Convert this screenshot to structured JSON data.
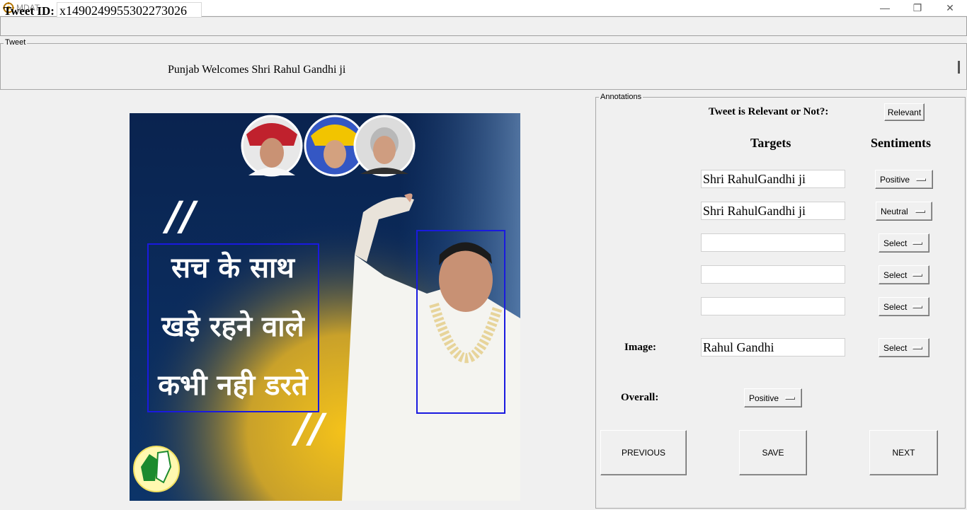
{
  "window": {
    "title": "MDAT",
    "minimize": "—",
    "maximize": "❐",
    "close": "✕"
  },
  "tweet": {
    "id_label": "Tweet ID:",
    "id_value": "x1490249955302273026",
    "legend": "Tweet",
    "text": "Punjab Welcomes Shri Rahul Gandhi ji"
  },
  "image_panel": {
    "quote_open": "//",
    "quote_close": "//",
    "lines": [
      "सच के साथ",
      "खड़े रहने वाले",
      "कभी नही डरते"
    ]
  },
  "annotations": {
    "legend": "Annotations",
    "relevance_question": "Tweet is Relevant or Not?:",
    "relevance_button": "Relevant",
    "targets_heading": "Targets",
    "sentiments_heading": "Sentiments",
    "targets": [
      {
        "value": "Shri RahulGandhi ji",
        "sentiment": "Positive"
      },
      {
        "value": "Shri RahulGandhi ji",
        "sentiment": "Neutral"
      },
      {
        "value": "",
        "sentiment": "Select"
      },
      {
        "value": "",
        "sentiment": "Select"
      },
      {
        "value": "",
        "sentiment": "Select"
      }
    ],
    "image_label": "Image:",
    "image_target": "Rahul Gandhi",
    "image_sentiment": "Select",
    "overall_label": "Overall:",
    "overall_sentiment": "Positive"
  },
  "buttons": {
    "previous": "PREVIOUS",
    "save": "SAVE",
    "next": "NEXT"
  },
  "colors": {
    "window_bg": "#f0f0f0",
    "bbox_blue": "#1a1adf",
    "poster_navy": "#0b2a5c",
    "poster_gold": "#e7b520"
  }
}
